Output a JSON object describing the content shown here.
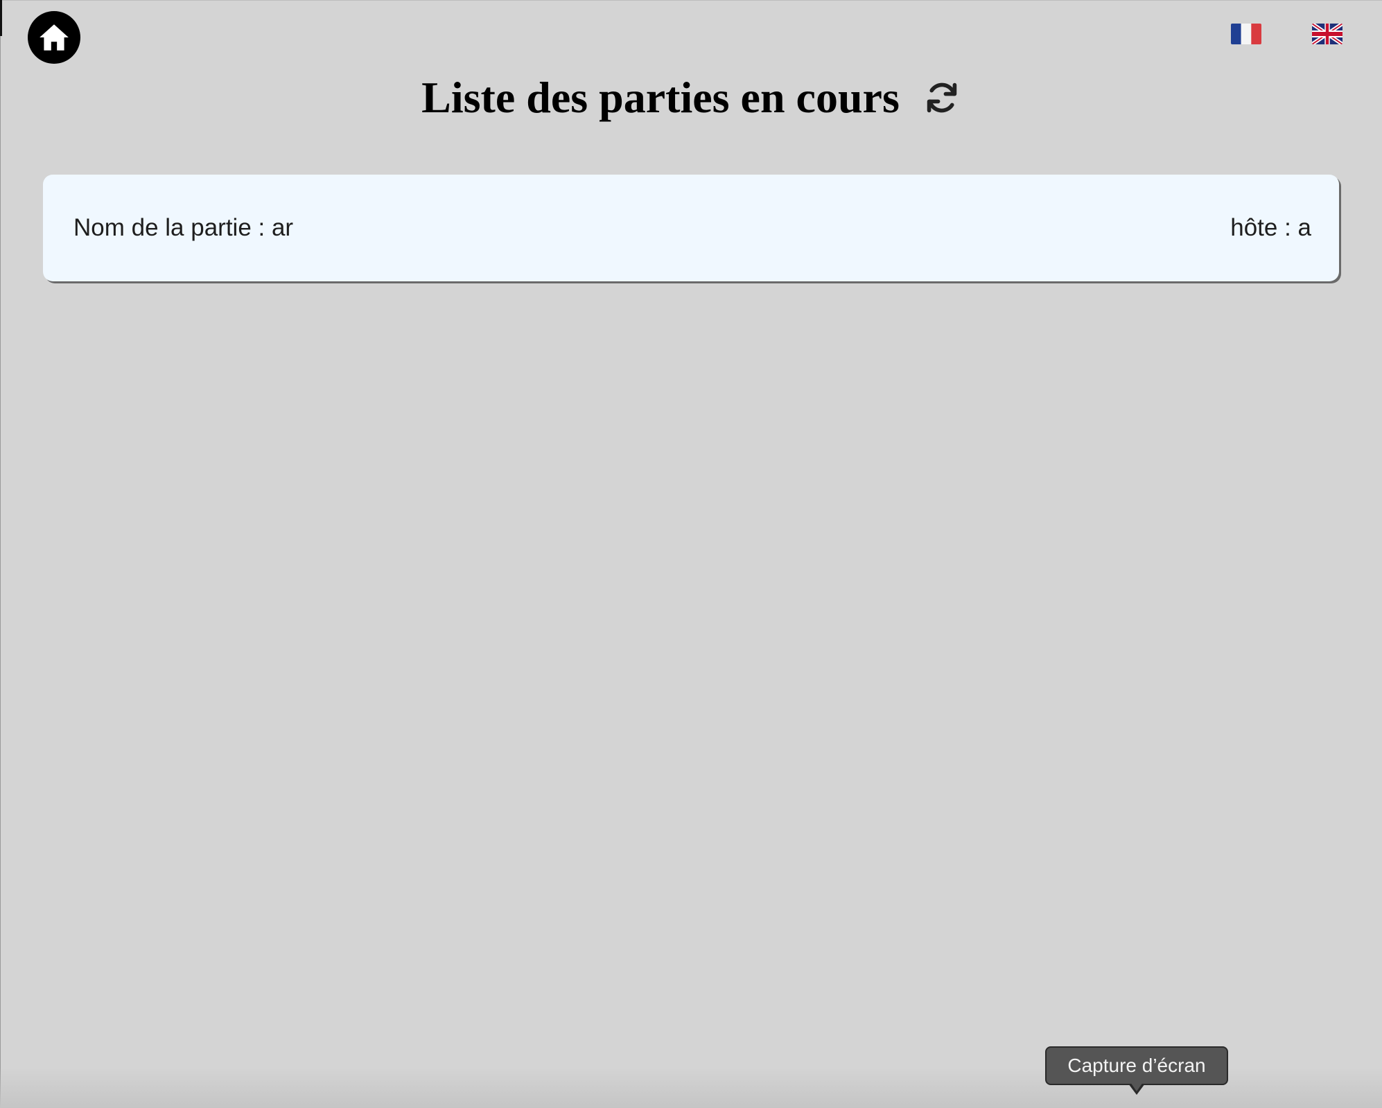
{
  "header": {
    "home_icon": "home-icon",
    "languages": [
      {
        "code": "fr",
        "icon": "flag-france-icon"
      },
      {
        "code": "en",
        "icon": "flag-uk-icon"
      }
    ]
  },
  "main": {
    "title": "Liste des parties en cours",
    "refresh_icon": "refresh-icon",
    "games": [
      {
        "name": "Nom de la partie : ar",
        "host": "hôte : a"
      }
    ]
  },
  "tooltip": {
    "text": "Capture d’écran"
  },
  "colors": {
    "background": "#d4d4d4",
    "card_background": "#f0f8ff",
    "home_button": "#000000",
    "tooltip_background": "#555555"
  }
}
